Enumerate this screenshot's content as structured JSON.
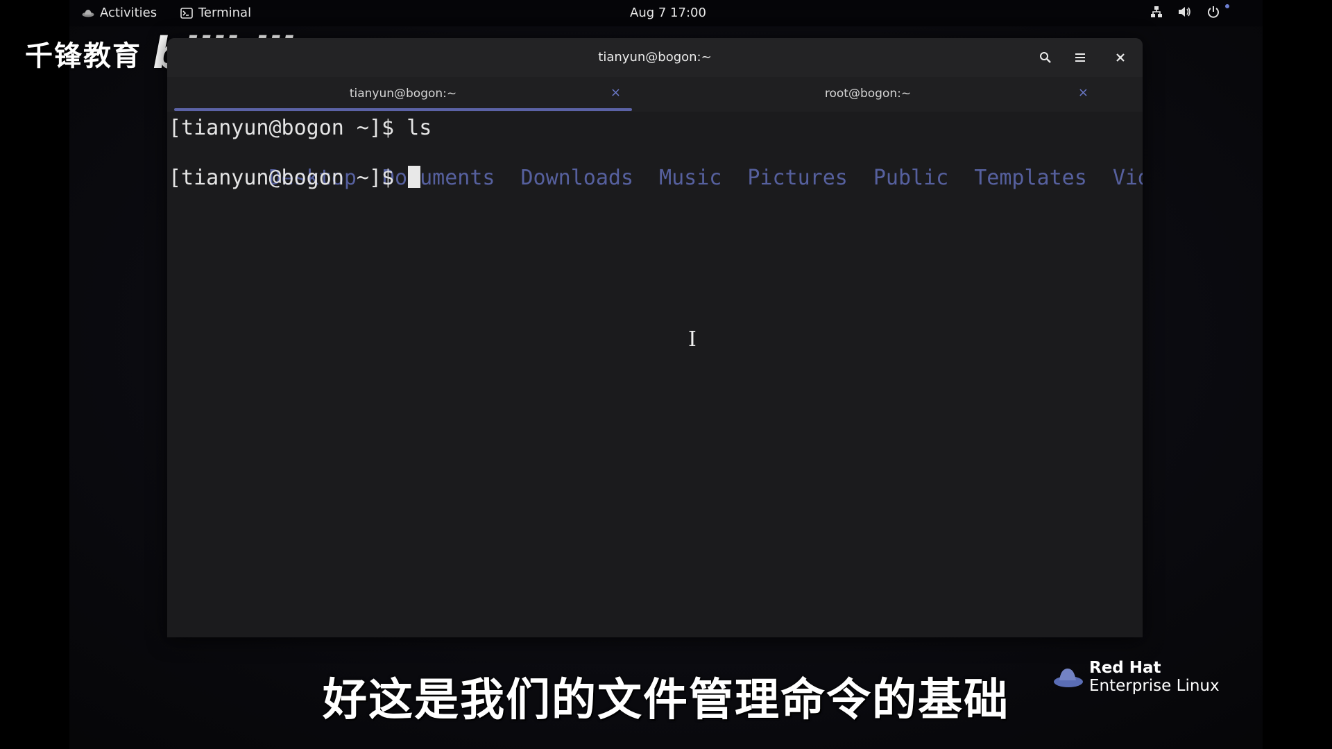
{
  "topbar": {
    "activities_label": "Activities",
    "app_label": "Terminal",
    "clock": "Aug 7  17:00"
  },
  "watermark": {
    "text": "千锋教育",
    "logo": "bilibili"
  },
  "window": {
    "title": "tianyun@bogon:~",
    "tabs": [
      {
        "label": "tianyun@bogon:~",
        "active": true
      },
      {
        "label": "root@bogon:~",
        "active": false
      }
    ]
  },
  "terminal": {
    "line1": "[tianyun@bogon ~]$ ls",
    "dirs": [
      "Desktop",
      "Documents",
      "Downloads",
      "Music",
      "Pictures",
      "Public",
      "Templates",
      "Videos"
    ],
    "prompt": "[tianyun@bogon ~]$ "
  },
  "subtitle": "好这是我们的文件管理命令的基础",
  "brand": {
    "line1": "Red Hat",
    "line2": "Enterprise Linux"
  },
  "colors": {
    "accent": "#5b62a6",
    "directory": "#56609e",
    "terminal_bg": "#1b1b1d",
    "tab_close": "#6b79c9"
  }
}
